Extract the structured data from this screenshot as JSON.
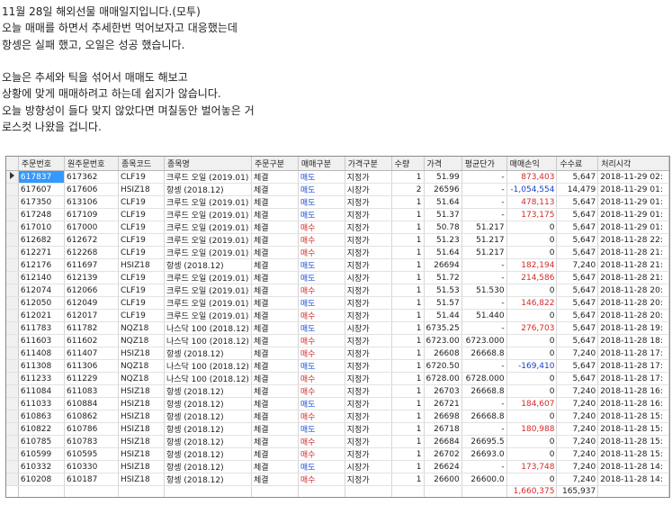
{
  "intro": [
    "11월 28일 해외선물 매매일지입니다.(모투)",
    "오늘 매매를 하면서 추세한번 먹어보자고 대응했는데",
    "항셍은 실패 했고, 오일은 성공 했습니다.",
    "",
    "오늘은 추세와 틱을 섞어서 매매도 해보고",
    "상황에 맞게 매매하려고 하는데 쉽지가 않습니다.",
    "오늘 방향성이 들다 맞지 않았다면 며칠동안 벌어놓은 거",
    "로스컷 나왔을 겁니다."
  ],
  "columns": [
    "주문번호",
    "원주문번호",
    "종목코드",
    "종목명",
    "주문구분",
    "매매구분",
    "가격구분",
    "수량",
    "가격",
    "평균단가",
    "매매손익",
    "수수료",
    "처리시각"
  ],
  "rows": [
    [
      "617837",
      "617362",
      "CLF19",
      "크루드 오일 (2019.01)",
      "체결",
      "매도",
      "지정가",
      "1",
      "51.99",
      "-",
      "873,403",
      "5,647",
      "2018-11-29 02:"
    ],
    [
      "617607",
      "617606",
      "HSIZ18",
      "항셍 (2018.12)",
      "체결",
      "매도",
      "시장가",
      "2",
      "26596",
      "-",
      "-1,054,554",
      "14,479",
      "2018-11-29 01:"
    ],
    [
      "617350",
      "613106",
      "CLF19",
      "크루드 오일 (2019.01)",
      "체결",
      "매도",
      "지정가",
      "1",
      "51.64",
      "-",
      "478,113",
      "5,647",
      "2018-11-29 01:"
    ],
    [
      "617248",
      "617109",
      "CLF19",
      "크루드 오일 (2019.01)",
      "체결",
      "매도",
      "지정가",
      "1",
      "51.37",
      "-",
      "173,175",
      "5,647",
      "2018-11-29 01:"
    ],
    [
      "617010",
      "617000",
      "CLF19",
      "크루드 오일 (2019.01)",
      "체결",
      "매수",
      "지정가",
      "1",
      "50.78",
      "51.217",
      "0",
      "5,647",
      "2018-11-29 01:"
    ],
    [
      "612682",
      "612672",
      "CLF19",
      "크루드 오일 (2019.01)",
      "체결",
      "매수",
      "지정가",
      "1",
      "51.23",
      "51.217",
      "0",
      "5,647",
      "2018-11-28 22:"
    ],
    [
      "612271",
      "612268",
      "CLF19",
      "크루드 오일 (2019.01)",
      "체결",
      "매수",
      "지정가",
      "1",
      "51.64",
      "51.217",
      "0",
      "5,647",
      "2018-11-28 21:"
    ],
    [
      "612176",
      "611697",
      "HSIZ18",
      "항셍 (2018.12)",
      "체결",
      "매도",
      "지정가",
      "1",
      "26694",
      "-",
      "182,194",
      "7,240",
      "2018-11-28 21:"
    ],
    [
      "612140",
      "612139",
      "CLF19",
      "크루드 오일 (2019.01)",
      "체결",
      "매도",
      "시장가",
      "1",
      "51.72",
      "-",
      "214,586",
      "5,647",
      "2018-11-28 21:"
    ],
    [
      "612074",
      "612066",
      "CLF19",
      "크루드 오일 (2019.01)",
      "체결",
      "매수",
      "지정가",
      "1",
      "51.53",
      "51.530",
      "0",
      "5,647",
      "2018-11-28 20:"
    ],
    [
      "612050",
      "612049",
      "CLF19",
      "크루드 오일 (2019.01)",
      "체결",
      "매도",
      "지정가",
      "1",
      "51.57",
      "-",
      "146,822",
      "5,647",
      "2018-11-28 20:"
    ],
    [
      "612021",
      "612017",
      "CLF19",
      "크루드 오일 (2019.01)",
      "체결",
      "매수",
      "지정가",
      "1",
      "51.44",
      "51.440",
      "0",
      "5,647",
      "2018-11-28 20:"
    ],
    [
      "611783",
      "611782",
      "NQZ18",
      "나스닥 100 (2018.12)",
      "체결",
      "매도",
      "시장가",
      "1",
      "6735.25",
      "-",
      "276,703",
      "5,647",
      "2018-11-28 19:"
    ],
    [
      "611603",
      "611602",
      "NQZ18",
      "나스닥 100 (2018.12)",
      "체결",
      "매수",
      "지정가",
      "1",
      "6723.00",
      "6723.000",
      "0",
      "5,647",
      "2018-11-28 18:"
    ],
    [
      "611408",
      "611407",
      "HSIZ18",
      "항셍 (2018.12)",
      "체결",
      "매수",
      "지정가",
      "1",
      "26608",
      "26668.8",
      "0",
      "7,240",
      "2018-11-28 17:"
    ],
    [
      "611308",
      "611306",
      "NQZ18",
      "나스닥 100 (2018.12)",
      "체결",
      "매도",
      "지정가",
      "1",
      "6720.50",
      "-",
      "-169,410",
      "5,647",
      "2018-11-28 17:"
    ],
    [
      "611233",
      "611229",
      "NQZ18",
      "나스닥 100 (2018.12)",
      "체결",
      "매수",
      "지정가",
      "1",
      "6728.00",
      "6728.000",
      "0",
      "5,647",
      "2018-11-28 17:"
    ],
    [
      "611084",
      "611083",
      "HSIZ18",
      "항셍 (2018.12)",
      "체결",
      "매수",
      "지정가",
      "1",
      "26703",
      "26668.8",
      "0",
      "7,240",
      "2018-11-28 16:"
    ],
    [
      "611033",
      "610884",
      "HSIZ18",
      "항셍 (2018.12)",
      "체결",
      "매도",
      "지정가",
      "1",
      "26721",
      "-",
      "184,607",
      "7,240",
      "2018-11-28 16:"
    ],
    [
      "610863",
      "610862",
      "HSIZ18",
      "항셍 (2018.12)",
      "체결",
      "매수",
      "지정가",
      "1",
      "26698",
      "26668.8",
      "0",
      "7,240",
      "2018-11-28 15:"
    ],
    [
      "610822",
      "610786",
      "HSIZ18",
      "항셍 (2018.12)",
      "체결",
      "매도",
      "지정가",
      "1",
      "26718",
      "-",
      "180,988",
      "7,240",
      "2018-11-28 15:"
    ],
    [
      "610785",
      "610783",
      "HSIZ18",
      "항셍 (2018.12)",
      "체결",
      "매수",
      "지정가",
      "1",
      "26684",
      "26695.5",
      "0",
      "7,240",
      "2018-11-28 15:"
    ],
    [
      "610599",
      "610595",
      "HSIZ18",
      "항셍 (2018.12)",
      "체결",
      "매수",
      "지정가",
      "1",
      "26702",
      "26693.0",
      "0",
      "7,240",
      "2018-11-28 15:"
    ],
    [
      "610332",
      "610330",
      "HSIZ18",
      "항셍 (2018.12)",
      "체결",
      "매도",
      "시장가",
      "1",
      "26624",
      "-",
      "173,748",
      "7,240",
      "2018-11-28 14:"
    ],
    [
      "610208",
      "610187",
      "HSIZ18",
      "항셍 (2018.12)",
      "체결",
      "매수",
      "지정가",
      "1",
      "26600",
      "26600.0",
      "0",
      "7,240",
      "2018-11-28 14:"
    ]
  ],
  "totals": {
    "pnl": "1,660,375",
    "fee": "165,937"
  },
  "colors": {
    "sell": "#1a4fd8",
    "buy": "#d42a2a",
    "loss": "#1a3fc8",
    "profit": "#d42a2a",
    "selection": "#3399ff"
  }
}
